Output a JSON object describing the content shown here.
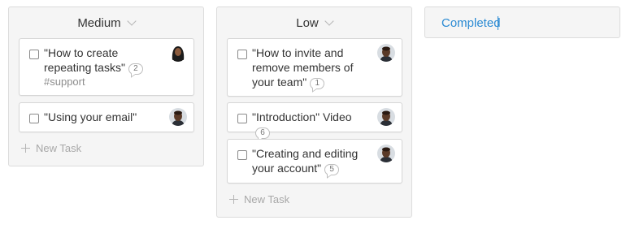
{
  "columns": {
    "medium": {
      "title": "Medium",
      "new_task_label": "New Task",
      "cards": [
        {
          "text": "\"How to create repeating tasks\"",
          "comments": "2",
          "tag": "#support",
          "avatar": "woman-avatar"
        },
        {
          "text": "\"Using your email\"",
          "avatar": "man-avatar"
        }
      ]
    },
    "low": {
      "title": "Low",
      "new_task_label": "New Task",
      "cards": [
        {
          "text": "\"How to invite and remove members of your team\"",
          "comments": "1",
          "avatar": "man-avatar"
        },
        {
          "text": "\"Introduction\" Video",
          "comments": "6",
          "avatar": "man-avatar"
        },
        {
          "text": "\"Creating and editing your account\"",
          "comments": "5",
          "avatar": "man-avatar"
        }
      ]
    },
    "completed": {
      "input_value": "Completed"
    }
  },
  "colors": {
    "accent": "#2a8ad3",
    "column_bg": "#f5f5f5",
    "card_border": "#d6d6d6"
  },
  "icons": [
    "chevron-down-icon",
    "checkbox-icon",
    "comment-icon",
    "plus-icon",
    "avatar"
  ]
}
